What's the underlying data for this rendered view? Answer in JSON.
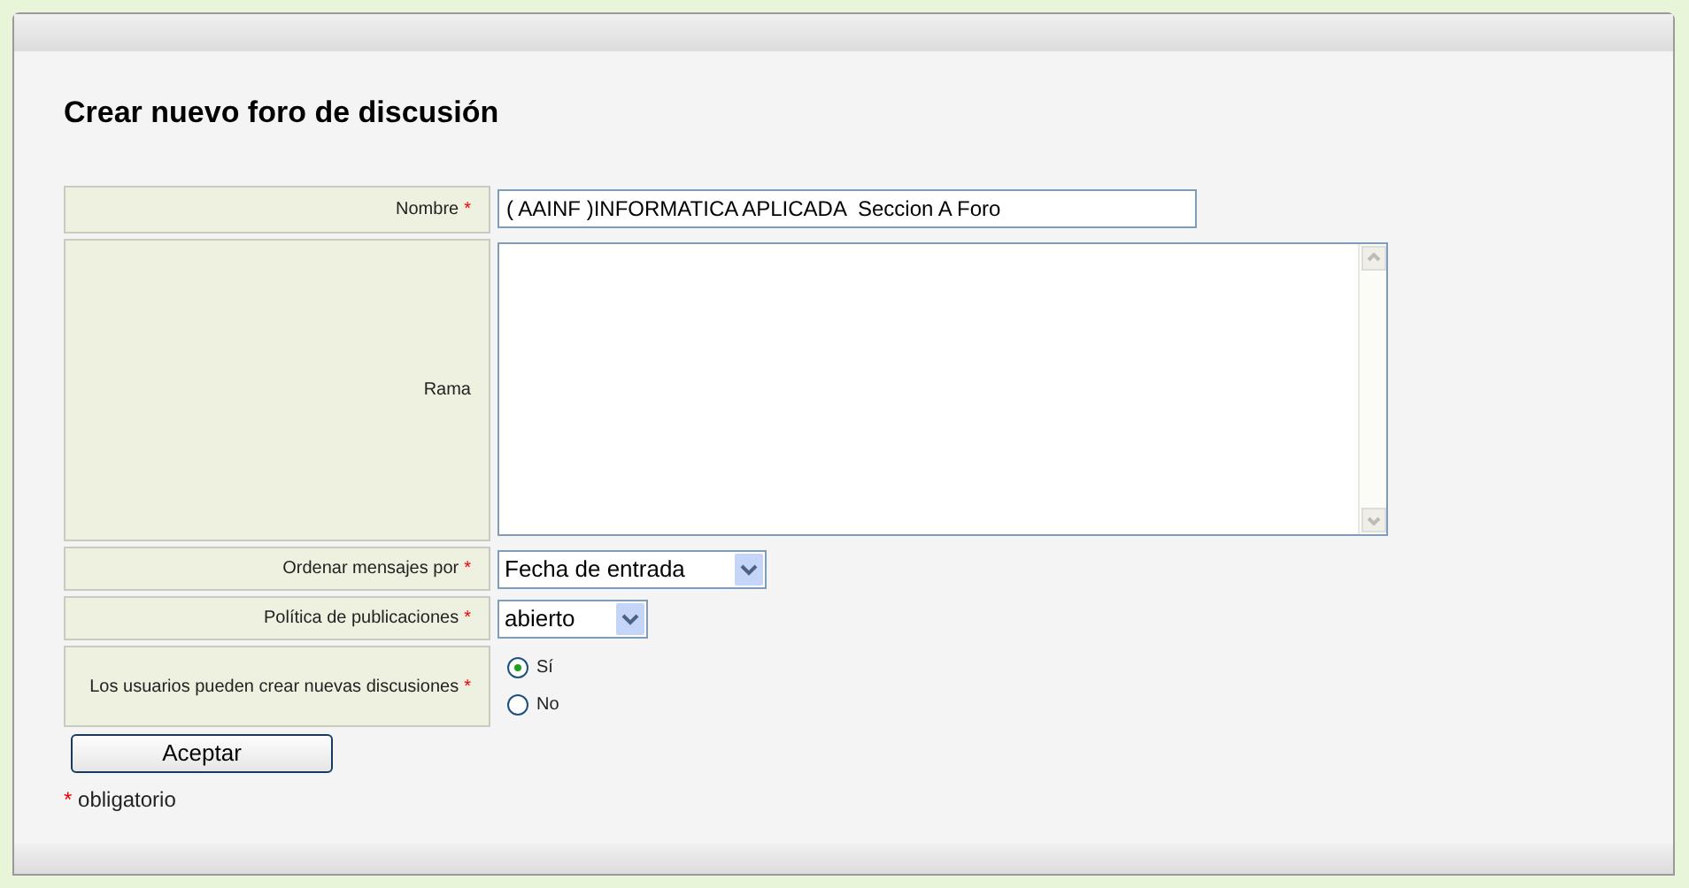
{
  "title": "Crear nuevo foro de discusión",
  "fields": [
    {
      "kind": "text",
      "label": "Nombre",
      "required": true,
      "value": "( AAINF )INFORMATICA APLICADA  Seccion A Foro"
    },
    {
      "kind": "textarea",
      "label": "Rama",
      "required": false
    },
    {
      "kind": "select",
      "label": "Ordenar mensajes por",
      "required": true,
      "value": "Fecha de entrada"
    },
    {
      "kind": "select",
      "label": "Política de publicaciones",
      "required": true,
      "value": "abierto"
    },
    {
      "kind": "radio",
      "label": "Los usuarios pueden crear nuevas discusiones",
      "required": true,
      "options": [
        {
          "label": "Sí",
          "selected": true
        },
        {
          "label": "No",
          "selected": false
        }
      ]
    }
  ],
  "submit": "Aceptar",
  "required_note": {
    "mark": "*",
    "text": "obligatorio"
  }
}
